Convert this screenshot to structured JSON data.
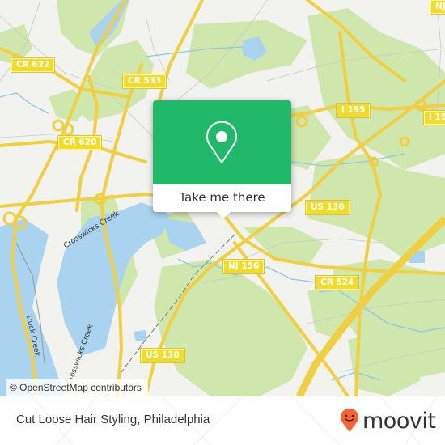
{
  "map": {
    "road_labels": [
      {
        "text": "CR 622"
      },
      {
        "text": "CR 533"
      },
      {
        "text": "CR 620"
      },
      {
        "text": "I 195"
      },
      {
        "text": "I 19"
      },
      {
        "text": "NJ"
      },
      {
        "text": "US 130"
      },
      {
        "text": "NJ 156"
      },
      {
        "text": "CR 524"
      },
      {
        "text": "US 130"
      }
    ],
    "water_labels": [
      {
        "text": "Crosswicks Creek"
      },
      {
        "text": "Duck Creek"
      },
      {
        "text": "Crosswicks Creek"
      }
    ],
    "attribution": "© OpenStreetMap contributors",
    "colors": {
      "land": "#f2f2ee",
      "park": "#cfe6ad",
      "water": "#a9d3ee",
      "road": "#f5dc4a"
    }
  },
  "popup": {
    "icon": "location-pin-icon",
    "button_label": "Take me there",
    "accent": "#20b96a"
  },
  "footer": {
    "place_title": "Cut Loose Hair Styling, Philadelphia",
    "brand": "moovit",
    "brand_icon": "moovit-smiley-pin-icon",
    "brand_color": "#f26430"
  }
}
